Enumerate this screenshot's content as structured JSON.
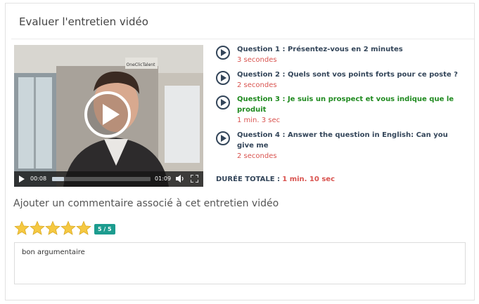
{
  "panel": {
    "title": "Evaluer l'entretien vidéo"
  },
  "video": {
    "current_time": "00:08",
    "duration": "01:09",
    "progress": 0.12,
    "sign_text": "OneClicTalent"
  },
  "questions": [
    {
      "title": "Question 1 : Présentez-vous en 2 minutes",
      "duration": "3 secondes",
      "active": false
    },
    {
      "title": "Question 2 : Quels sont vos points forts pour ce poste ?",
      "duration": "2 secondes",
      "active": false
    },
    {
      "title": "Question 3 : Je suis un prospect et vous indique que le produit",
      "duration": "1 min. 3 sec",
      "active": true
    },
    {
      "title": "Question 4 :  Answer the question in English: Can you give me",
      "duration": "2 secondes",
      "active": false
    }
  ],
  "total": {
    "label": "DURÉE TOTALE :",
    "value": "1 min. 10 sec"
  },
  "comment": {
    "heading": "Ajouter un commentaire associé à cet entretien vidéo",
    "rating": 5,
    "rating_badge": "5 / 5",
    "text": "bon argumentaire"
  },
  "colors": {
    "question_title": "#34465a",
    "question_active": "#1f8a1f",
    "duration": "#d9534f",
    "badge": "#1c9c8f",
    "star": "#f5c842"
  }
}
